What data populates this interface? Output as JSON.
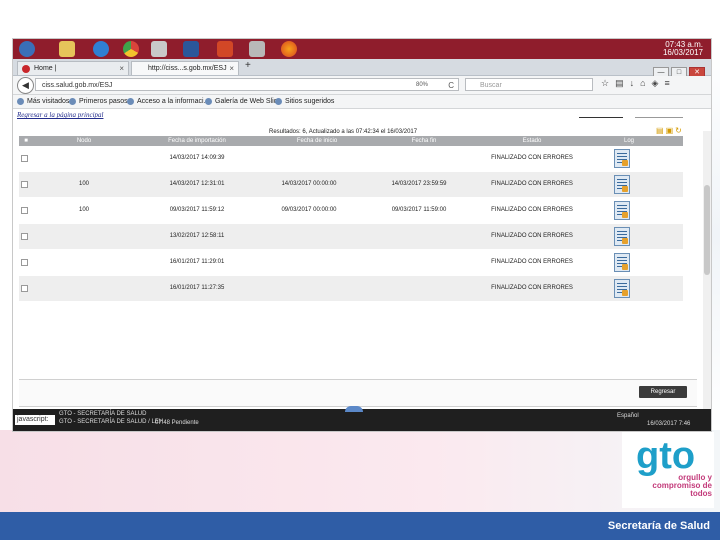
{
  "taskbar": {
    "clock": "07:43 a.m.",
    "date": "16/03/2017",
    "icons": [
      "windows-start-icon",
      "folder-icon",
      "ie-icon",
      "chrome-icon",
      "chrome-icon",
      "word-icon",
      "powerpoint-icon",
      "tool-icon",
      "firefox-icon"
    ]
  },
  "browser": {
    "tabs": [
      {
        "label": "Home |",
        "close": "×"
      },
      {
        "label": "http://ciss...s.gob.mx/ESJ",
        "close": "×"
      }
    ],
    "new_tab": "+",
    "url": "ciss.salud.gob.mx/ESJ",
    "zoom": "80%",
    "reload": "C",
    "search_placeholder": "Buscar",
    "bookmarks": [
      "Más visitados",
      "Primeros pasos",
      "Acceso a la informaci...",
      "Galería de Web Slice",
      "Sitios sugeridos"
    ]
  },
  "page": {
    "return_link": "Regresar a la página principal",
    "results": "Resultados: 6, Actualizado a las 07:42:34 el 16/03/2017",
    "columns": [
      "",
      "Nodo",
      "Fecha de importación",
      "Fecha de inicio",
      "Fecha fin",
      "Estado",
      "Log"
    ],
    "rows": [
      {
        "nodo": "",
        "importacion": "14/03/2017 14:09:39",
        "inicio": "",
        "fin": "",
        "estado": "FINALIZADO CON ERRORES"
      },
      {
        "nodo": "100",
        "importacion": "14/03/2017 12:31:01",
        "inicio": "14/03/2017 00:00:00",
        "fin": "14/03/2017 23:59:59",
        "estado": "FINALIZADO CON ERRORES"
      },
      {
        "nodo": "100",
        "importacion": "09/03/2017 11:59:12",
        "inicio": "09/03/2017 00:00:00",
        "fin": "09/03/2017 11:59:00",
        "estado": "FINALIZADO CON ERRORES"
      },
      {
        "nodo": "",
        "importacion": "13/02/2017 12:58:11",
        "inicio": "",
        "fin": "",
        "estado": "FINALIZADO CON ERRORES"
      },
      {
        "nodo": "",
        "importacion": "16/01/2017 11:29:01",
        "inicio": "",
        "fin": "",
        "estado": "FINALIZADO CON ERRORES"
      },
      {
        "nodo": "",
        "importacion": "16/01/2017 11:27:35",
        "inicio": "",
        "fin": "",
        "estado": "FINALIZADO CON ERRORES"
      }
    ],
    "regresar_button": "Regresar"
  },
  "status": {
    "js": "javascript:",
    "line1": "GTO - SECRETARÍA DE SALUD",
    "line2": "GTO - SECRETARÍA DE SALUD / LEH",
    "task": "07:48 Pendiente",
    "language": "Español",
    "datetime": "16/03/2017 7:46"
  },
  "slide": {
    "logo_text": "gto",
    "tagline": "orgullo y compromiso de todos",
    "footer": "Secretaría de Salud"
  }
}
